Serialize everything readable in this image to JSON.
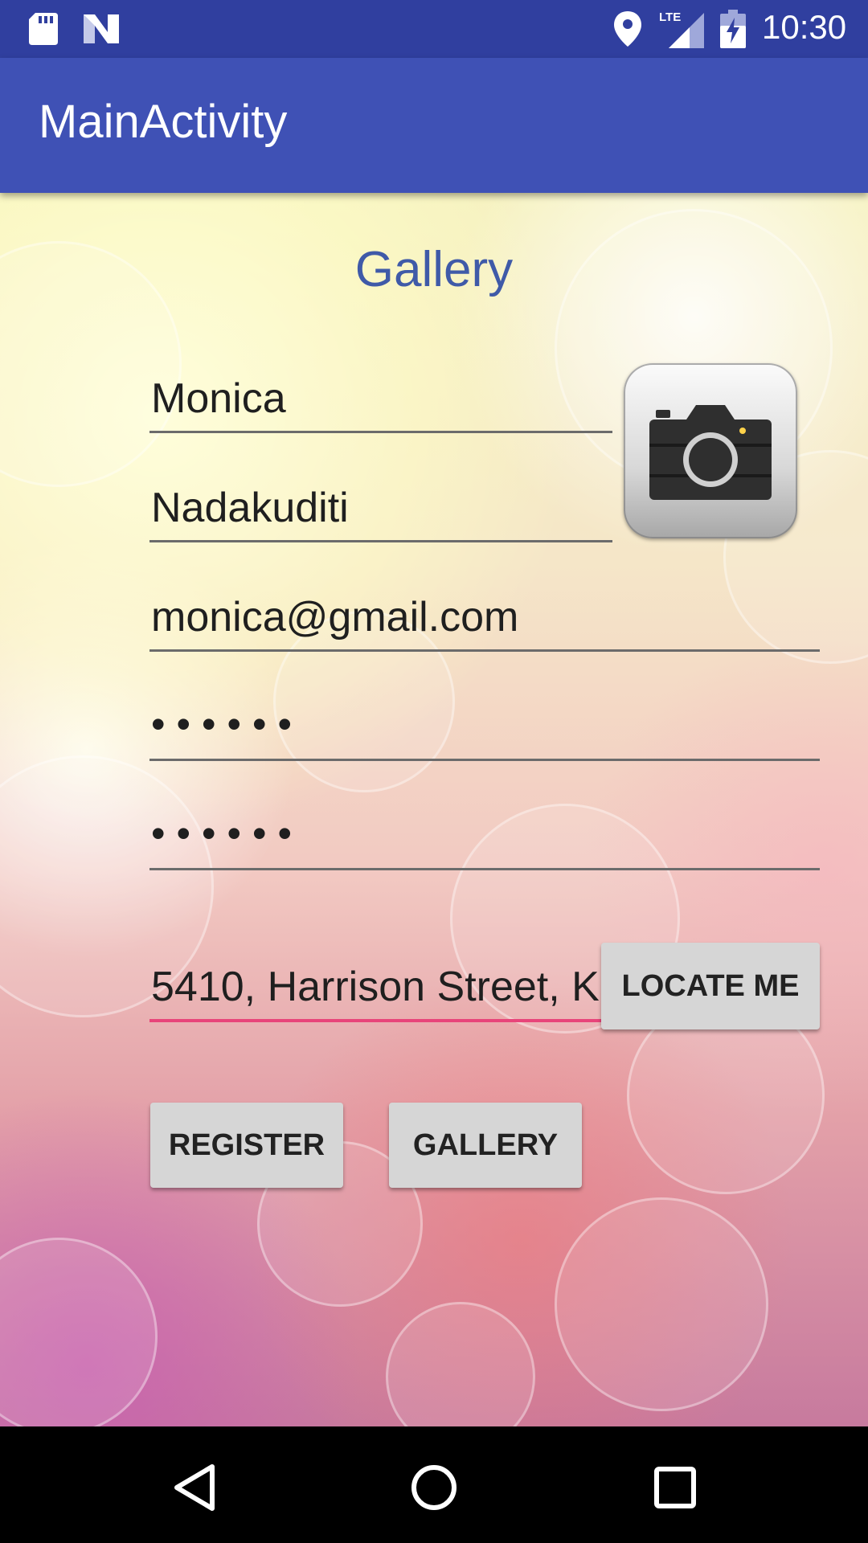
{
  "status_bar": {
    "time": "10:30",
    "network_label": "LTE",
    "icons": [
      "sd-card-icon",
      "n-notification-icon",
      "location-icon",
      "lte-signal-icon",
      "battery-charging-icon"
    ]
  },
  "app_bar": {
    "title": "MainActivity"
  },
  "form": {
    "heading": "Gallery",
    "first_name": "Monica",
    "last_name": "Nadakuditi",
    "email": "monica@gmail.com",
    "password": "••••••",
    "confirm_password": "••••••",
    "address": "5410, Harrison Street, K",
    "locate_label": "LOCATE ME",
    "register_label": "REGISTER",
    "gallery_label": "GALLERY",
    "camera_icon": "camera-icon"
  },
  "nav_bar": {
    "icons": [
      "back-icon",
      "home-icon",
      "recents-icon"
    ]
  },
  "colors": {
    "status_bar": "#303f9f",
    "app_bar": "#3f51b5",
    "accent": "#e8457a",
    "heading": "#3f5aa8",
    "button": "#d6d6d6"
  }
}
